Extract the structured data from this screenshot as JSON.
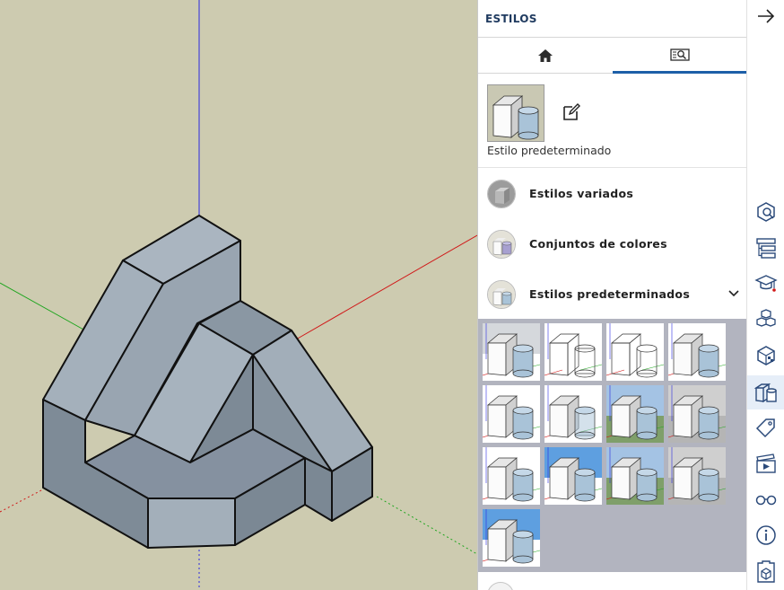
{
  "panel": {
    "title": "ESTILOS",
    "tabs": [
      {
        "name": "home",
        "icon": "home-icon",
        "active": false
      },
      {
        "name": "browse",
        "icon": "browse-styles-icon",
        "active": true
      }
    ],
    "current_style_label": "Estilo predeterminado",
    "categories": [
      {
        "label": "Estilos variados"
      },
      {
        "label": "Conjuntos de colores"
      },
      {
        "label": "Estilos predeterminados",
        "expanded": true
      }
    ],
    "thumbnails": [
      {
        "kind": "sky"
      },
      {
        "kind": "wire"
      },
      {
        "kind": "wire-hidden"
      },
      {
        "kind": "plain"
      },
      {
        "kind": "plain"
      },
      {
        "kind": "xray"
      },
      {
        "kind": "green"
      },
      {
        "kind": "gray"
      },
      {
        "kind": "plain"
      },
      {
        "kind": "blue"
      },
      {
        "kind": "green"
      },
      {
        "kind": "gray"
      },
      {
        "kind": "blue-selected"
      }
    ]
  },
  "rightbar": {
    "icons": [
      "arrow-right-icon",
      "entity-info-icon",
      "outliner-icon",
      "instructor-icon",
      "components-icon",
      "materials-icon",
      "styles-icon",
      "tags-icon",
      "scenes-icon",
      "shadows-glasses-icon",
      "info-icon",
      "warehouse-icon"
    ]
  },
  "colors": {
    "accent": "#1d5fa8",
    "viewport_bg": "#cdcbb0",
    "model_face": "#a6b2bd",
    "model_side": "#7d8a96"
  }
}
